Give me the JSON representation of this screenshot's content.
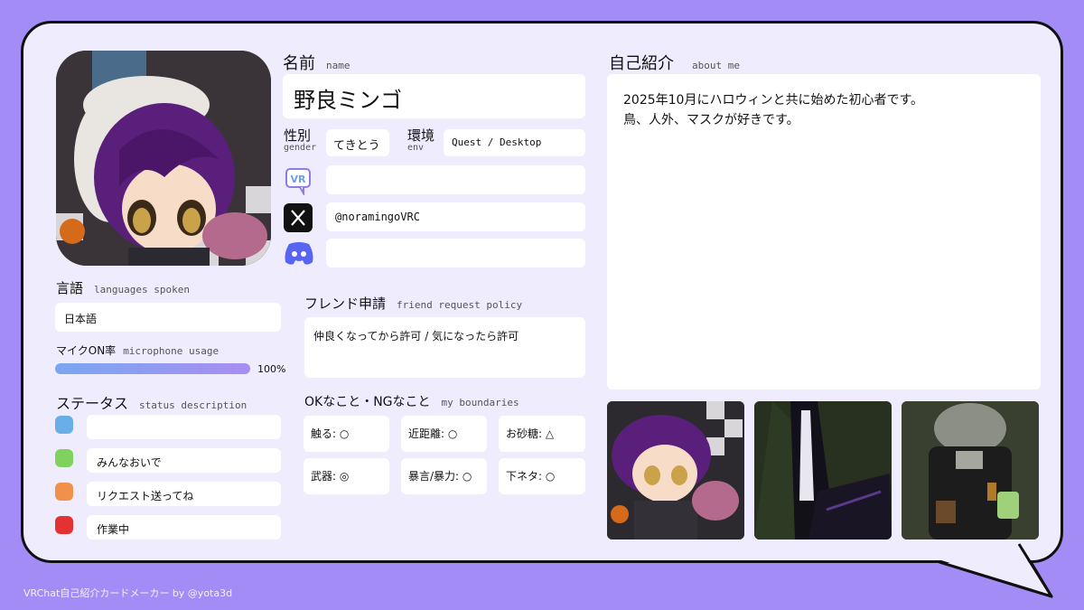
{
  "name": {
    "label": "名前",
    "sub": "name",
    "value": "野良ミンゴ"
  },
  "gender": {
    "label": "性別",
    "sub": "gender",
    "value": "てきとう"
  },
  "env": {
    "label": "環境",
    "sub": "env",
    "value": "Quest / Desktop"
  },
  "socials": {
    "vrchat": "",
    "x": "@noramingoVRC",
    "discord": ""
  },
  "language": {
    "label": "言語",
    "sub": "languages spoken",
    "value": "日本語"
  },
  "mic": {
    "label": "マイクON率",
    "sub": "microphone usage",
    "percent_text": "100%",
    "fraction": 1.0
  },
  "status": {
    "label": "ステータス",
    "sub": "status description",
    "items": [
      {
        "color": "#6aaee8",
        "text": ""
      },
      {
        "color": "#7fd35c",
        "text": "みんなおいで"
      },
      {
        "color": "#f0904a",
        "text": "リクエスト送ってね"
      },
      {
        "color": "#e43131",
        "text": "作業中"
      }
    ]
  },
  "friend": {
    "label": "フレンド申請",
    "sub": "friend request policy",
    "value": "仲良くなってから許可 / 気になったら許可"
  },
  "boundaries": {
    "label": "OKなこと・NGなこと",
    "sub": "my boundaries",
    "items": [
      "触る: ○",
      "近距離: ○",
      "お砂糖: △",
      "武器: ◎",
      "暴言/暴力: ○",
      "下ネタ: ○"
    ]
  },
  "about": {
    "label": "自己紹介",
    "sub": "about me",
    "line1": "2025年10月にハロウィンと共に始めた初心者です。",
    "line2": "鳥、人外、マスクが好きです。"
  },
  "footer": "VRChat自己紹介カードメーカー by @yota3d",
  "colors": {
    "background": "#a48cf6",
    "card": "#efedfd",
    "mic_bar_start": "#7aa7ef",
    "mic_bar_end": "#a98ef2"
  }
}
